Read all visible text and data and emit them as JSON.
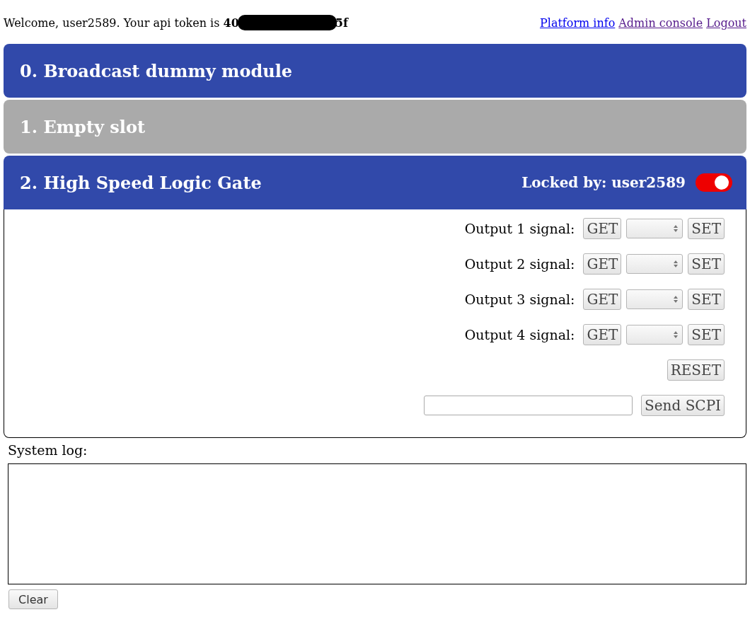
{
  "header": {
    "welcome": "Welcome, user2589. Your api token is",
    "token_start": "40",
    "token_end": "5f",
    "links": [
      {
        "label": "Platform info",
        "visited": false
      },
      {
        "label": "Admin console",
        "visited": true
      },
      {
        "label": "Logout",
        "visited": true
      }
    ]
  },
  "modules": [
    {
      "kind": "module",
      "title": "0. Broadcast dummy module"
    },
    {
      "kind": "empty",
      "title": "1. Empty slot"
    },
    {
      "kind": "module",
      "title": "2. High Speed Logic Gate",
      "locked_by": "Locked by: user2589",
      "lock_on": true,
      "expanded": true,
      "outputs": [
        {
          "label": "Output 1 signal:",
          "get": "GET",
          "set": "SET"
        },
        {
          "label": "Output 2 signal:",
          "get": "GET",
          "set": "SET"
        },
        {
          "label": "Output 3 signal:",
          "get": "GET",
          "set": "SET"
        },
        {
          "label": "Output 4 signal:",
          "get": "GET",
          "set": "SET"
        }
      ],
      "reset": "RESET",
      "scpi_button": "Send SCPI"
    }
  ],
  "log": {
    "label": "System log:",
    "clear": "Clear"
  }
}
